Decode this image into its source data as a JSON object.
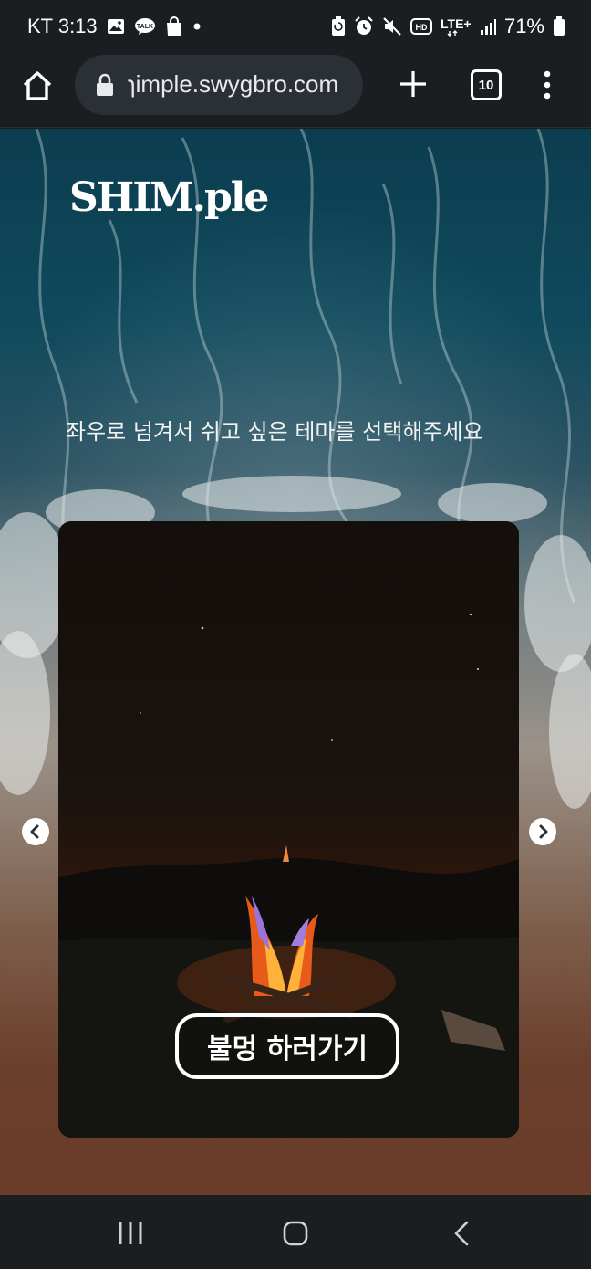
{
  "status_bar": {
    "carrier_time": "KT 3:13",
    "network": "LTE+",
    "battery_percent": "71%",
    "icons": [
      "gallery-icon",
      "talk-icon",
      "shopping-bag-icon",
      "dot-icon",
      "battery-saver-icon",
      "alarm-icon",
      "mute-icon",
      "hd-icon",
      "signal-icon",
      "battery-icon"
    ]
  },
  "browser": {
    "url": "ɿimple.swygbro.com",
    "tab_count": "10",
    "icons": [
      "home-icon",
      "lock-icon",
      "plus-icon",
      "tabs-icon",
      "more-vert-icon"
    ]
  },
  "page": {
    "logo": "SHIM.ple",
    "instruction": "좌우로 넘겨서 쉬고 싶은 테마를 선택해주세요",
    "card": {
      "theme": "campfire",
      "button_label": "불멍 하러가기"
    },
    "carousel_icons": [
      "chevron-left-icon",
      "chevron-right-icon"
    ]
  },
  "nav_bar": {
    "icons": [
      "recent-apps-icon",
      "home-nav-icon",
      "back-icon"
    ]
  }
}
